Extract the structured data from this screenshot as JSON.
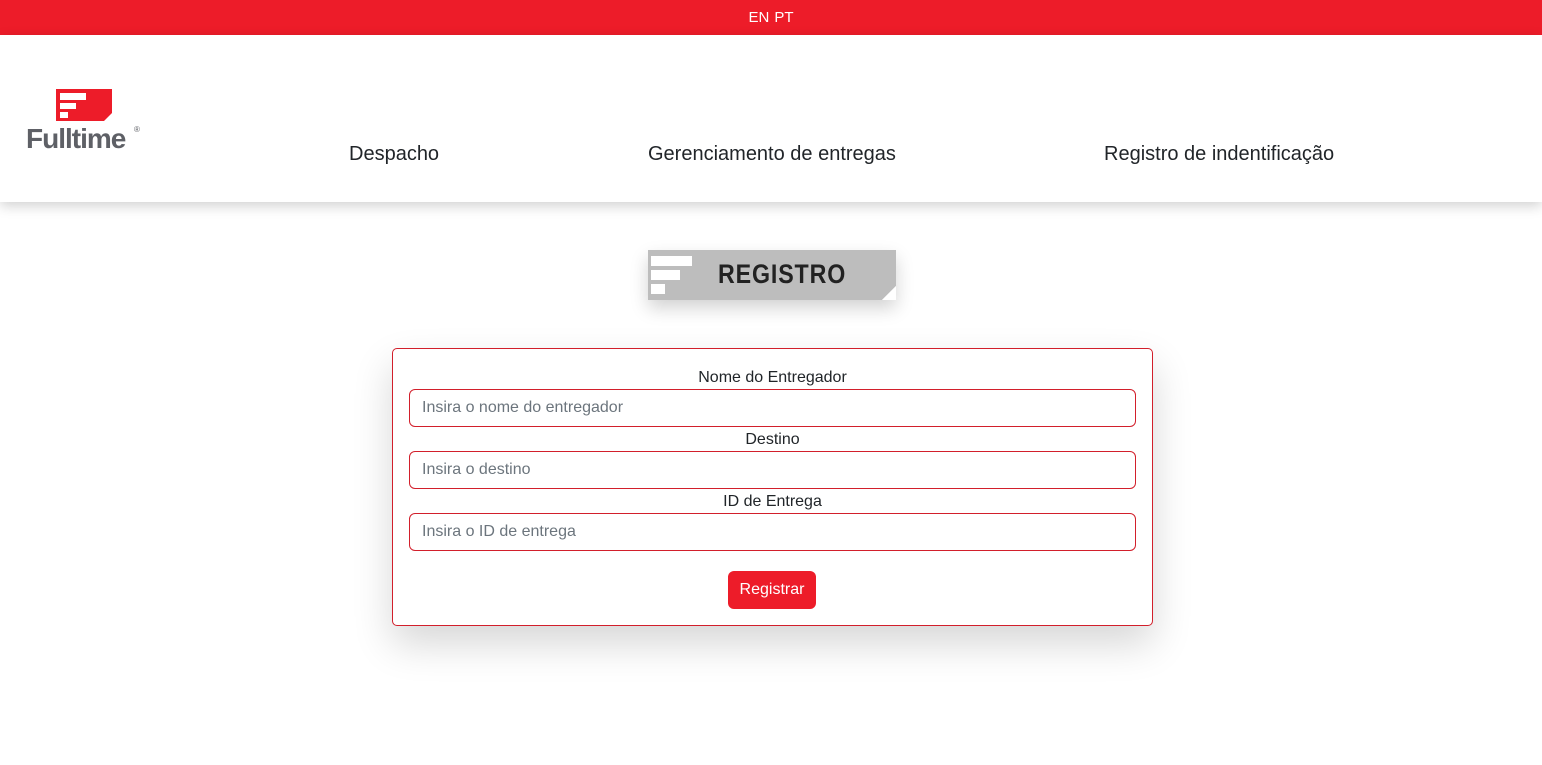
{
  "language_bar": {
    "options": [
      "EN",
      "PT"
    ]
  },
  "brand": {
    "name": "Fulltime",
    "registered_mark": "®",
    "primary_color": "#ed1c29",
    "text_color": "#5e6066"
  },
  "nav": {
    "items": [
      {
        "label": "Despacho"
      },
      {
        "label": "Gerenciamento de entregas"
      },
      {
        "label": "Registro de indentificação"
      }
    ]
  },
  "page": {
    "title": "REGISTRO",
    "title_banner_color": "#bdbdbd"
  },
  "form": {
    "fields": [
      {
        "label": "Nome do Entregador",
        "placeholder": "Insira o nome do entregador",
        "value": ""
      },
      {
        "label": "Destino",
        "placeholder": "Insira o destino",
        "value": ""
      },
      {
        "label": "ID de Entrega",
        "placeholder": "Insira o ID de entrega",
        "value": ""
      }
    ],
    "submit_label": "Registrar",
    "border_color": "#d21f2b"
  }
}
